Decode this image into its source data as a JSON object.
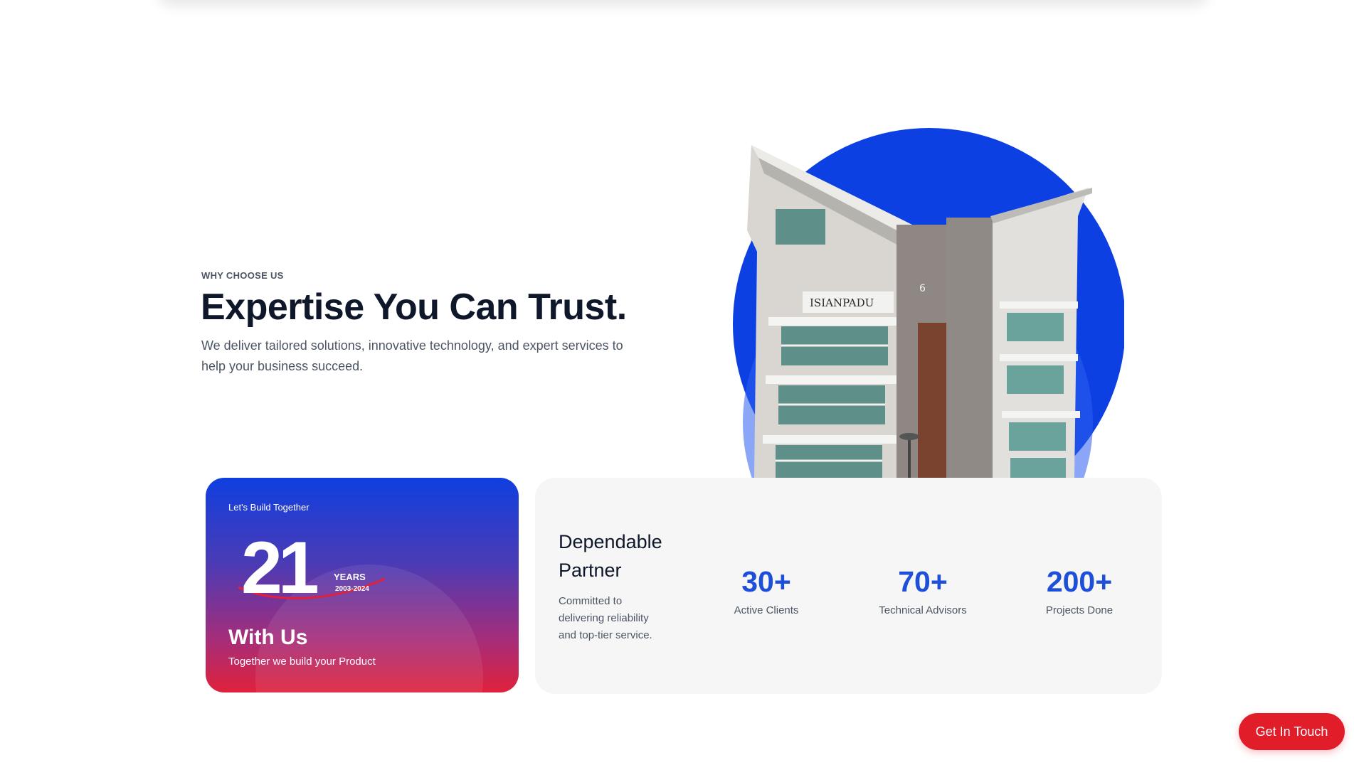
{
  "intro": {
    "eyebrow": "WHY CHOOSE US",
    "headline": "Expertise You Can Trust.",
    "description": "We deliver tailored solutions, innovative technology, and expert services to help your business succeed."
  },
  "hero_image": {
    "building_sign": "ISIANPADU",
    "floor_number": "6"
  },
  "years_card": {
    "kicker": "Let's Build Together",
    "years_number": "21",
    "years_word": "YEARS",
    "years_range": "2003-2024",
    "title": "With Us",
    "subtitle": "Together we build your Product"
  },
  "stats_card": {
    "title": "Dependable Partner",
    "description": "Committed to delivering reliability and top-tier service.",
    "stats": [
      {
        "value": "30+",
        "label": "Active Clients"
      },
      {
        "value": "70+",
        "label": "Technical Advisors"
      },
      {
        "value": "200+",
        "label": "Projects Done"
      }
    ]
  },
  "cta": {
    "label": "Get In Touch"
  },
  "colors": {
    "brand_blue": "#0f3fe0",
    "stat_blue": "#1d4fd8",
    "accent_red": "#e11d2a"
  }
}
